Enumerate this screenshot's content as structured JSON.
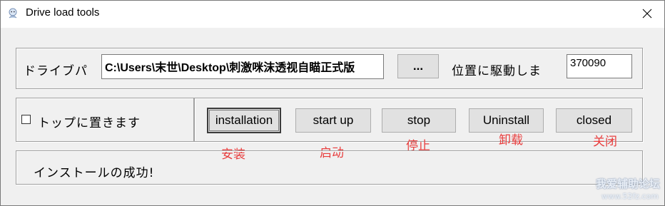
{
  "window": {
    "title": "Drive load tools",
    "icon": "app-icon",
    "close_glyph": "✕"
  },
  "drive_row": {
    "label": "ドライブパ",
    "path_value": "C:\\Users\\末世\\Desktop\\刺激咪沫透视自瞄正式版",
    "browse_label": "...",
    "position_label": "位置に駆動しま",
    "position_value": "370090"
  },
  "topmost": {
    "label": "トップに置きます",
    "checked": false
  },
  "buttons": {
    "installation": "installation",
    "start_up": "start up",
    "stop": "stop",
    "uninstall": "Uninstall",
    "closed": "closed"
  },
  "annotations": {
    "installation": "安装",
    "start_up": "启动",
    "stop": "停止",
    "uninstall": "卸载",
    "closed": "关闭"
  },
  "status": {
    "text": "インストールの成功!"
  },
  "watermark": {
    "line1": "我爱辅助论坛",
    "line2": "www.52fz.com"
  },
  "colors": {
    "annotation": "#e83c3c",
    "window_bg": "#f0f0f0"
  }
}
